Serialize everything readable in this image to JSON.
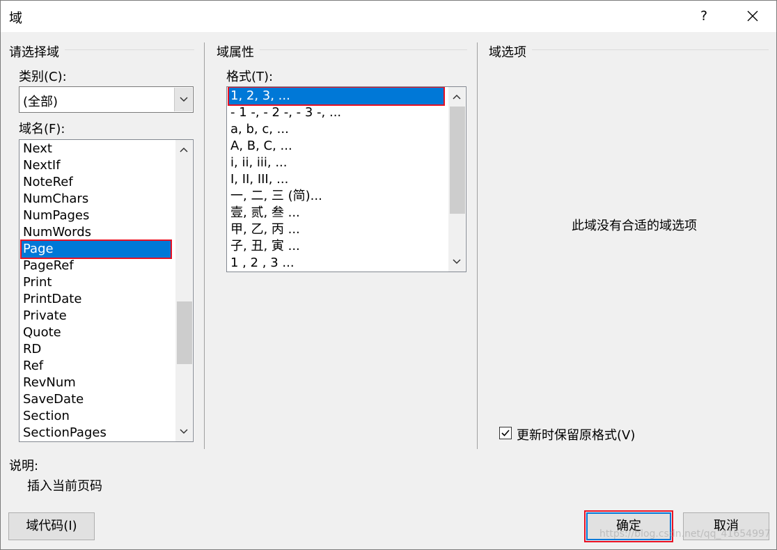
{
  "window": {
    "title": "域",
    "help_label": "?"
  },
  "select_field": {
    "group_title": "请选择域",
    "category_label": "类别(C):",
    "category_value": "(全部)",
    "field_names_label": "域名(F):",
    "field_names": [
      "Next",
      "NextIf",
      "NoteRef",
      "NumChars",
      "NumPages",
      "NumWords",
      "Page",
      "PageRef",
      "Print",
      "PrintDate",
      "Private",
      "Quote",
      "RD",
      "Ref",
      "RevNum",
      "SaveDate",
      "Section",
      "SectionPages"
    ],
    "selected_field": "Page"
  },
  "field_properties": {
    "group_title": "域属性",
    "format_label": "格式(T):",
    "formats": [
      "1, 2, 3, ...",
      "- 1 -, - 2 -, - 3 -, ...",
      "a, b, c, ...",
      "A, B, C, ...",
      "i, ii, iii, ...",
      "I, II, III, ...",
      "一, 二, 三 (简)...",
      "壹, 贰, 叁 ...",
      "甲, 乙, 丙 ...",
      "子, 丑, 寅 ...",
      "1 , 2 , 3  ..."
    ],
    "selected_format": "1, 2, 3, ..."
  },
  "field_options": {
    "group_title": "域选项",
    "no_options_text": "此域没有合适的域选项",
    "preserve_format_label": "更新时保留原格式(V)",
    "preserve_format_checked": true
  },
  "description": {
    "label": "说明:",
    "text": "插入当前页码"
  },
  "buttons": {
    "field_codes": "域代码(I)",
    "ok": "确定",
    "cancel": "取消"
  },
  "watermark": "https://blog.csdn.net/qq_41654997"
}
